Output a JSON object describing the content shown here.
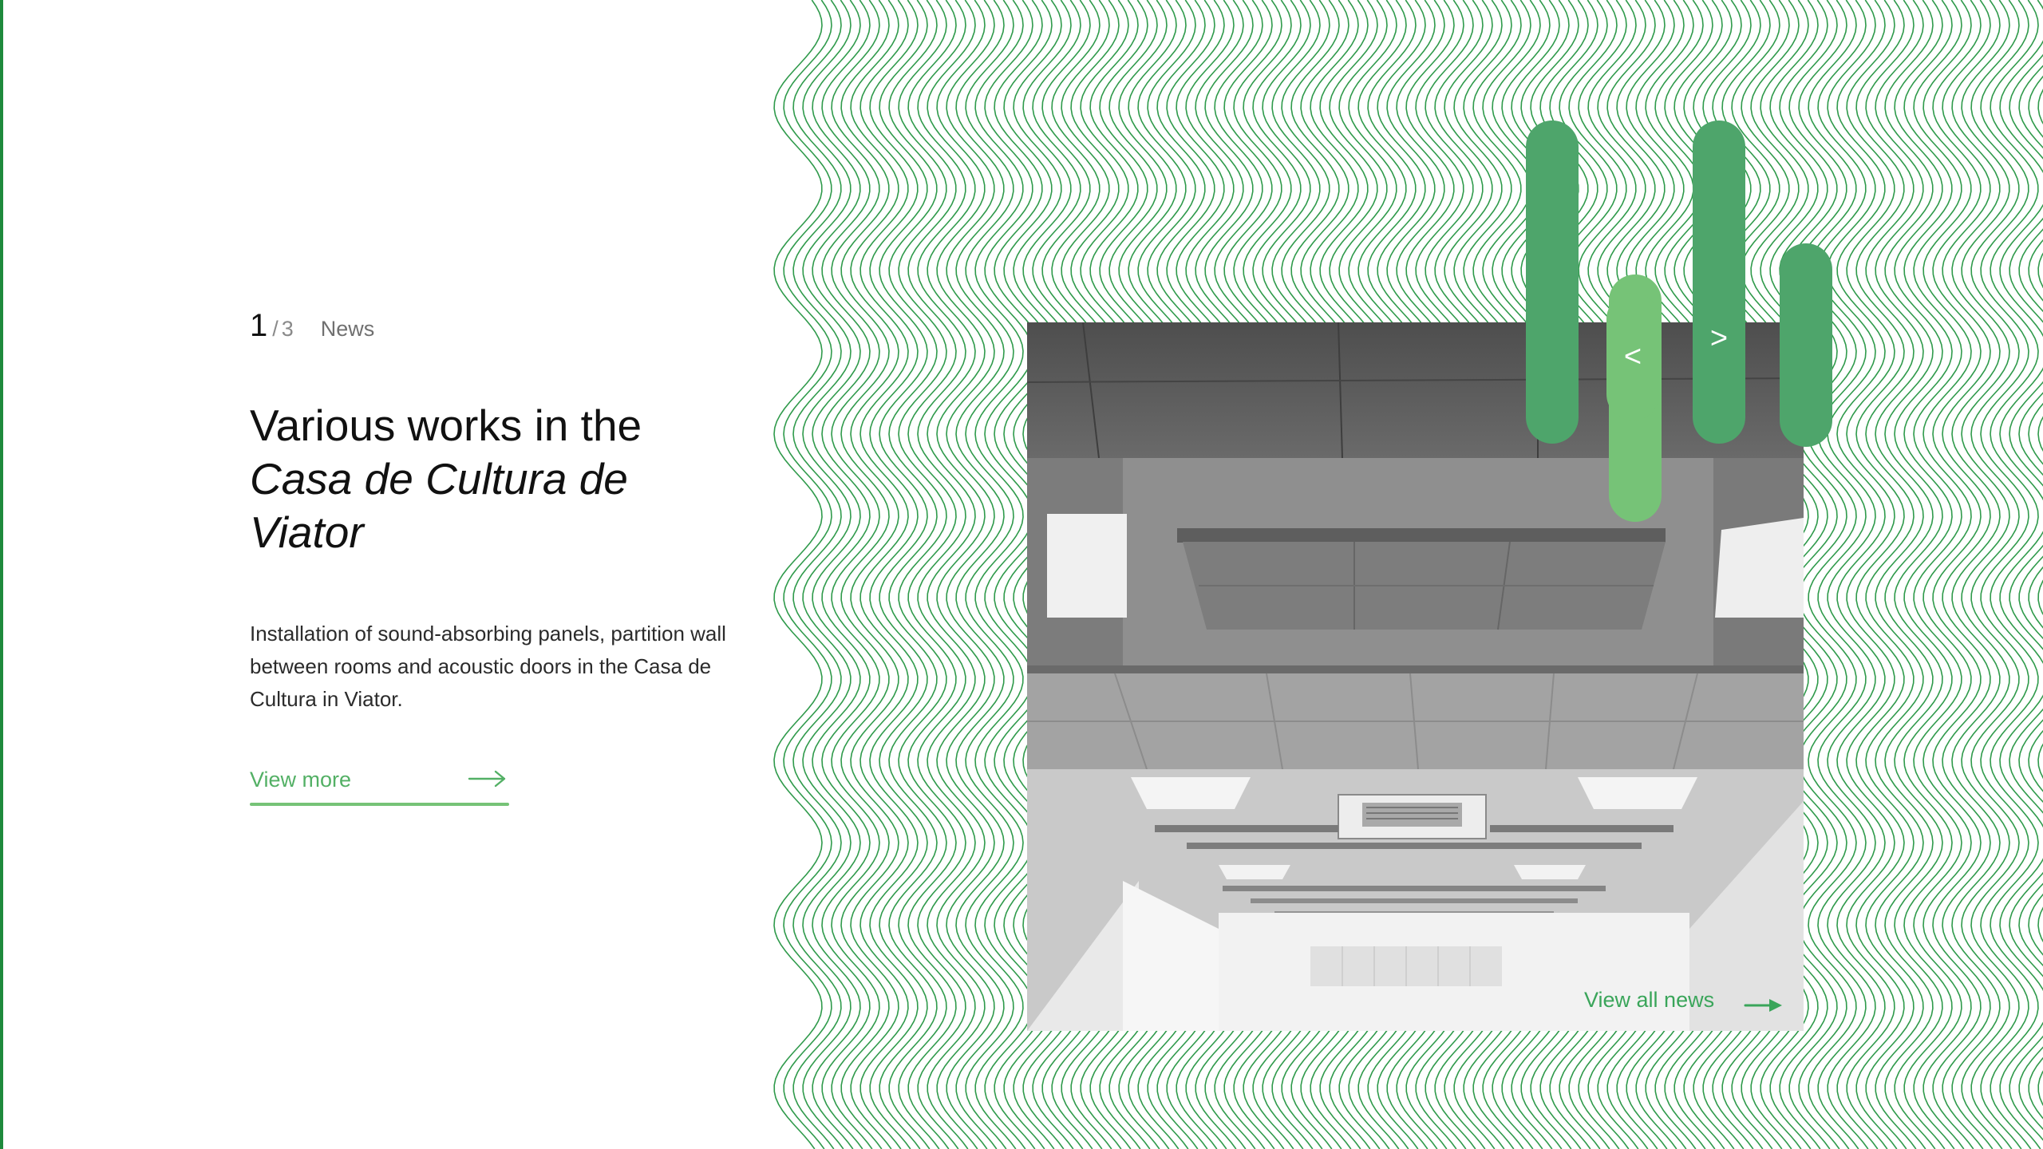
{
  "slider": {
    "current": "1",
    "separator": "/",
    "total": "3",
    "section": "News"
  },
  "article": {
    "title_line1": "Various works in the",
    "title_line2": "Casa de Cultura de",
    "title_line3": "Viator",
    "description": "Installation of sound-absorbing panels, partition wall between rooms and acoustic doors in the Casa de Cultura in Viator.",
    "link_label": "View more"
  },
  "nav": {
    "prev_glyph": "<",
    "next_glyph": ">"
  },
  "footer_link": {
    "label": "View all news"
  },
  "icons": {
    "view_more": "arrow-right-icon",
    "view_all": "arrow-right-icon",
    "prev": "chevron-left-icon",
    "next": "chevron-right-icon"
  },
  "colors": {
    "accent_light": "#76c377",
    "accent_mid": "#53b065",
    "accent_dark": "#4ea56b",
    "wave_line": "#2f9a4b",
    "left_rule": "#1e8a3c"
  }
}
